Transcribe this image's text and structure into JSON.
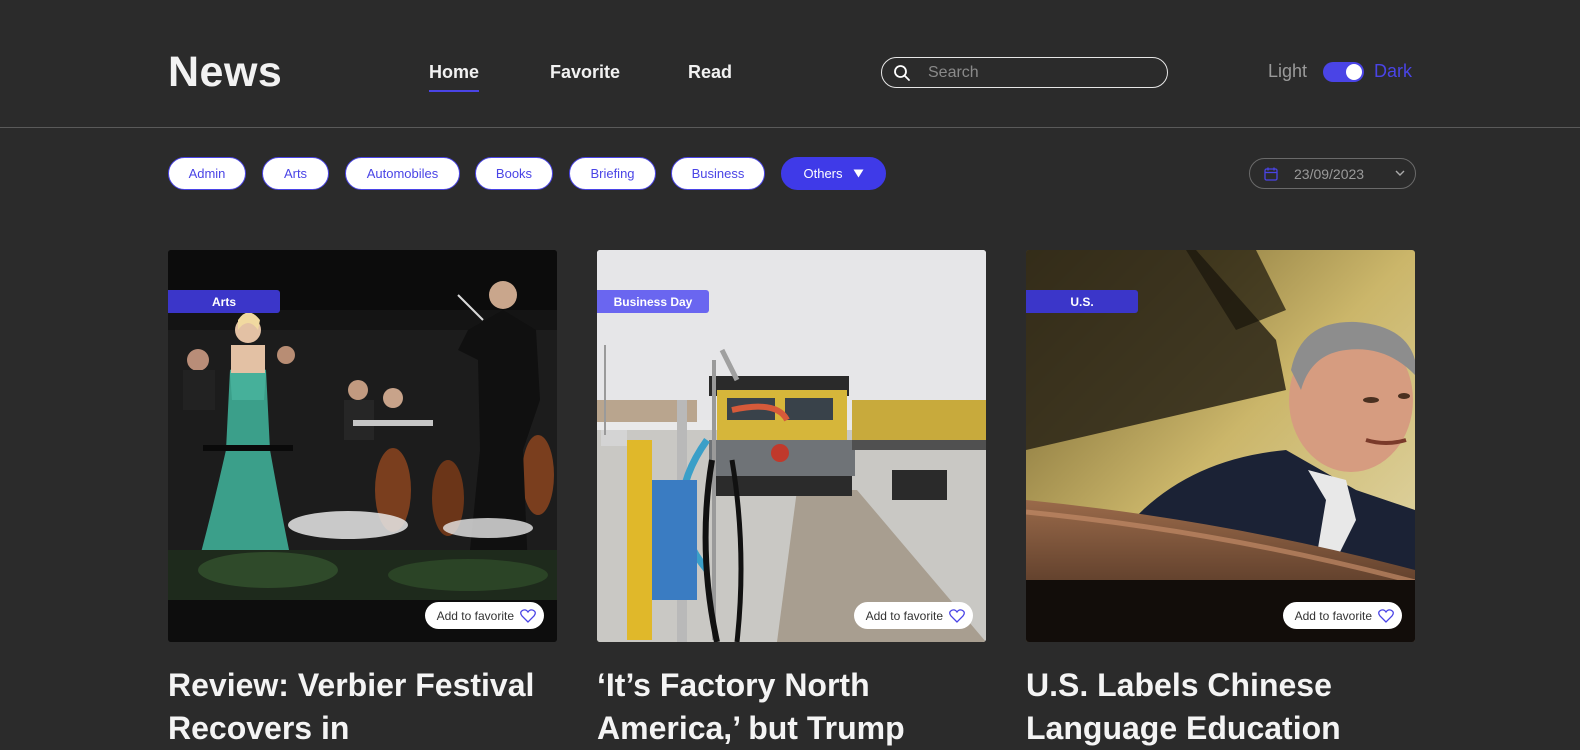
{
  "header": {
    "logo": "News",
    "nav": [
      {
        "label": "Home",
        "active": true
      },
      {
        "label": "Favorite",
        "active": false
      },
      {
        "label": "Read",
        "active": false
      }
    ],
    "search_placeholder": "Search",
    "search_icon": "search-icon",
    "theme": {
      "light_label": "Light",
      "dark_label": "Dark",
      "dark_enabled": true
    }
  },
  "filters": {
    "categories": [
      "Admin",
      "Arts",
      "Automobiles",
      "Books",
      "Briefing",
      "Business"
    ],
    "more_label": "Others",
    "date": "23/09/2023"
  },
  "colors": {
    "background": "#2b2b2b",
    "accent": "#4a44e6",
    "text": "#ffffff",
    "muted": "#9a9a9a"
  },
  "articles": [
    {
      "section": "Arts",
      "title": "Review: Verbier Festival Recovers in",
      "favorite_label": "Add to favorite",
      "image": "orchestra concert with soprano singer in green gown",
      "badge_color": "#3b36c9"
    },
    {
      "section": "Business Day",
      "title": "‘It’s Factory North America,’ but Trump",
      "favorite_label": "Add to favorite",
      "image": "yellow freight locomotive at rail yard",
      "badge_color": "#6a66f0"
    },
    {
      "section": "U.S.",
      "title": "U.S. Labels Chinese Language Education",
      "favorite_label": "Add to favorite",
      "image": "man in suit speaking at hearing",
      "badge_color": "#3b36c9"
    }
  ]
}
